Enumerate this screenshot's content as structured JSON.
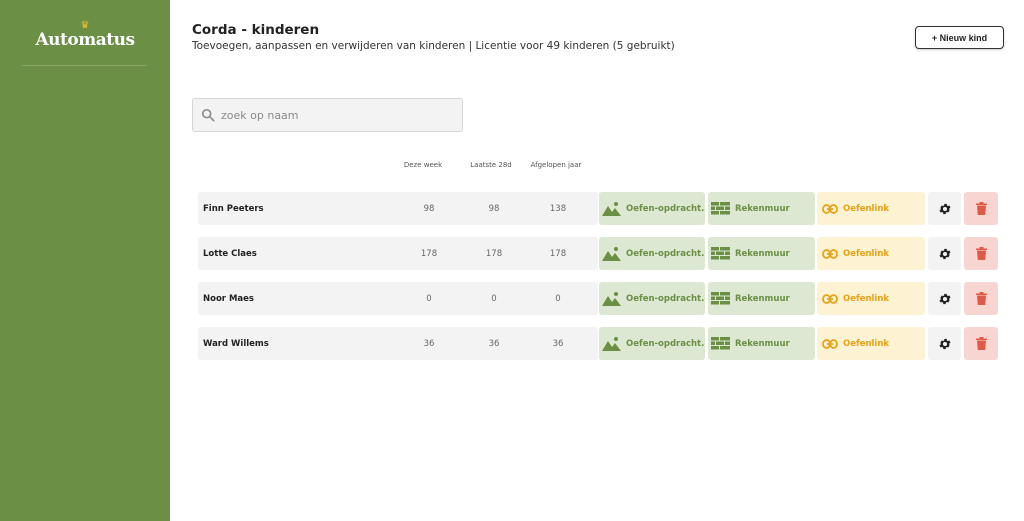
{
  "sidebar": {
    "logo_text": "Automatus",
    "crown_glyph": "♛"
  },
  "header": {
    "title": "Corda - kinderen",
    "subtitle": "Toevoegen, aanpassen en verwijderen van kinderen | Licentie voor 49 kinderen (5 gebruikt)",
    "new_button_label": "+ Nieuw kind"
  },
  "search": {
    "placeholder": "zoek op naam",
    "value": ""
  },
  "columns": [
    "Deze week",
    "Laatste 28d",
    "Afgelopen jaar"
  ],
  "rows": [
    {
      "name": "Finn Peeters",
      "week": "98",
      "d28": "98",
      "year": "138",
      "oef_label": "Oefen-opdracht...",
      "rek_label": "Rekenmuur",
      "link_label": "Oefenlink"
    },
    {
      "name": "Lotte Claes",
      "week": "178",
      "d28": "178",
      "year": "178",
      "oef_label": "Oefen-opdracht...",
      "rek_label": "Rekenmuur",
      "link_label": "Oefenlink"
    },
    {
      "name": "Noor Maes",
      "week": "0",
      "d28": "0",
      "year": "0",
      "oef_label": "Oefen-opdracht...",
      "rek_label": "Rekenmuur",
      "link_label": "Oefenlink"
    },
    {
      "name": "Ward Willems",
      "week": "36",
      "d28": "36",
      "year": "36",
      "oef_label": "Oefen-opdracht...",
      "rek_label": "Rekenmuur",
      "link_label": "Oefenlink"
    }
  ],
  "colors": {
    "sidebar": "#6a8f45",
    "green_text": "#6a8f45",
    "green_bg": "#dde8d2",
    "yellow_text": "#e8a214",
    "yellow_bg": "#fdf3d3",
    "red": "#e05a45",
    "red_bg": "#f7d6d2"
  },
  "icons": {
    "search": "search-icon",
    "oef": "mountain-image-icon",
    "rek": "brick-wall-icon",
    "link": "link-icon",
    "settings": "gear-icon",
    "delete": "trash-icon"
  }
}
